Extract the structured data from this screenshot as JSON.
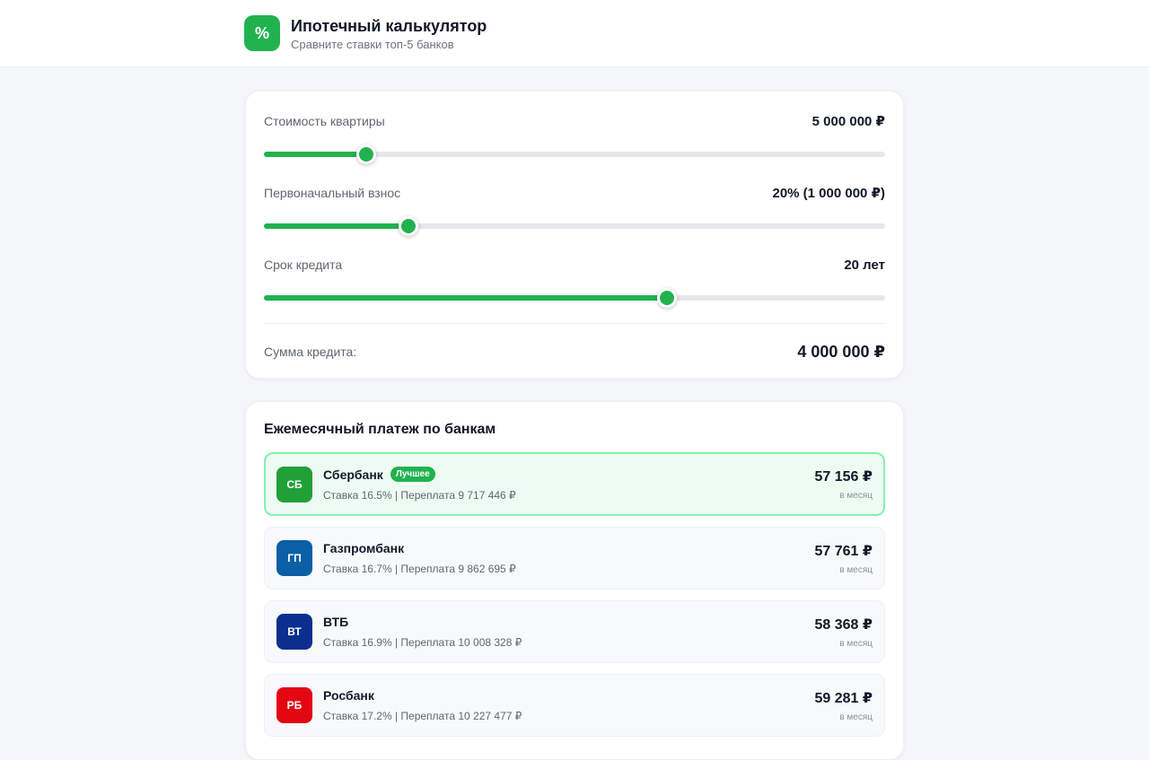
{
  "header": {
    "logo": "%",
    "title": "Ипотечный калькулятор",
    "subtitle": "Сравните ставки топ-5 банков"
  },
  "calculator": {
    "price": {
      "label": "Стоимость квартиры",
      "value": "5 000 000 ₽",
      "fraction": 0.165
    },
    "down_payment": {
      "label": "Первоначальный взнос",
      "value": "20% (1 000 000 ₽)",
      "fraction": 0.232
    },
    "term": {
      "label": "Срок кредита",
      "value": "20 лет",
      "fraction": 0.649
    },
    "loan_sum": {
      "label": "Сумма кредита:",
      "value": "4 000 000 ₽"
    }
  },
  "banks": {
    "title": "Ежемесячный платеж по банкам",
    "best_badge": "Лучшее",
    "items": [
      {
        "initials": "СБ",
        "name": "Сбербанк",
        "details": "Ставка 16.5% | Переплата 9 717 446 ₽",
        "amount": "57 156 ₽",
        "per": "в месяц",
        "color": "#21a038",
        "best": true
      },
      {
        "initials": "ГП",
        "name": "Газпромбанк",
        "details": "Ставка 16.7% | Переплата 9 862 695 ₽",
        "amount": "57 761 ₽",
        "per": "в месяц",
        "color": "#0b5fa5",
        "best": false
      },
      {
        "initials": "ВТ",
        "name": "ВТБ",
        "details": "Ставка 16.9% | Переплата 10 008 328 ₽",
        "amount": "58 368 ₽",
        "per": "в месяц",
        "color": "#0a2f8f",
        "best": false
      },
      {
        "initials": "РБ",
        "name": "Росбанк",
        "details": "Ставка 17.2% | Переплата 10 227 477 ₽",
        "amount": "59 281 ₽",
        "per": "в месяц",
        "color": "#e30613",
        "best": false
      }
    ]
  },
  "colors": {
    "accent": "#21b24f",
    "track": "#e5e7eb"
  }
}
